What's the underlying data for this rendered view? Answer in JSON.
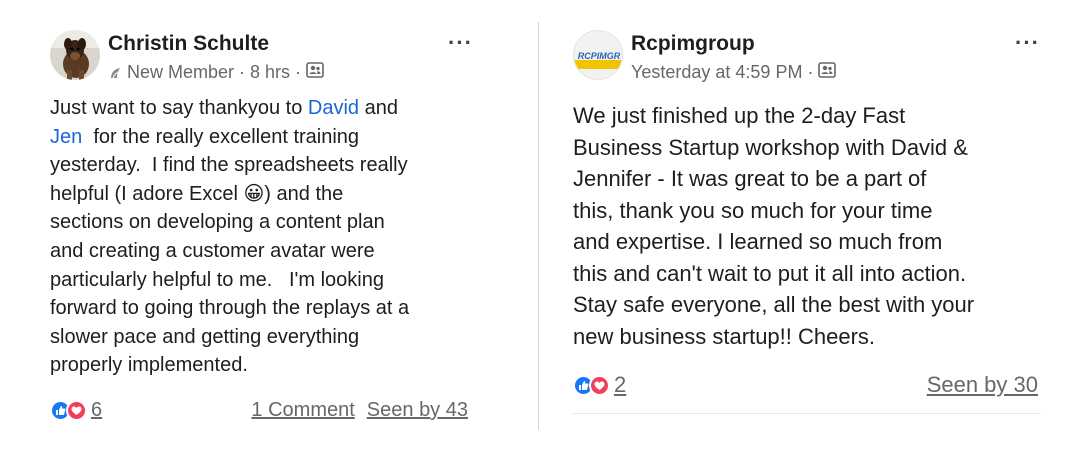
{
  "colors": {
    "like": "#1877f2",
    "love": "#f33e58",
    "mention": "#1a66d6",
    "meta": "#65676b"
  },
  "left_post": {
    "author": "Christin Schulte",
    "badge_icon": "new-member-icon",
    "badge": "New Member",
    "time": "8 hrs",
    "sep": "·",
    "audience_icon": "group-icon",
    "more": "···",
    "lines": [
      [
        "Just want to say thankyou to ",
        "David",
        " and"
      ],
      [
        "Jen",
        "  for the really excellent training"
      ],
      [
        "yesterday.  I find the spreadsheets really"
      ],
      [
        "helpful (I adore Excel ",
        "😀",
        ") and the"
      ],
      [
        "sections on developing a content plan"
      ],
      [
        "and creating a customer avatar were"
      ],
      [
        "particularly helpful to me.   I'm looking"
      ],
      [
        "forward to going through the replays at a"
      ],
      [
        "slower pace and getting everything"
      ],
      [
        "properly implemented."
      ]
    ],
    "reactions_count": "6",
    "comments": "1 Comment",
    "seen_by": "Seen by 43"
  },
  "right_post": {
    "author": "Rcpimgroup",
    "avatar_text": "RCPIMGR",
    "time": "Yesterday at 4:59 PM",
    "sep": "·",
    "audience_icon": "group-icon",
    "more": "···",
    "lines": [
      "We just finished up the 2-day Fast",
      "Business Startup workshop with David &",
      "Jennifer - It was great to be a part of",
      "this, thank you so much for your time",
      "and expertise. I learned so much from",
      "this and can't wait to put it all into action.",
      "Stay safe everyone, all the best with your",
      "new business startup!! Cheers."
    ],
    "reactions_count": "2",
    "seen_by": "Seen by 30"
  }
}
